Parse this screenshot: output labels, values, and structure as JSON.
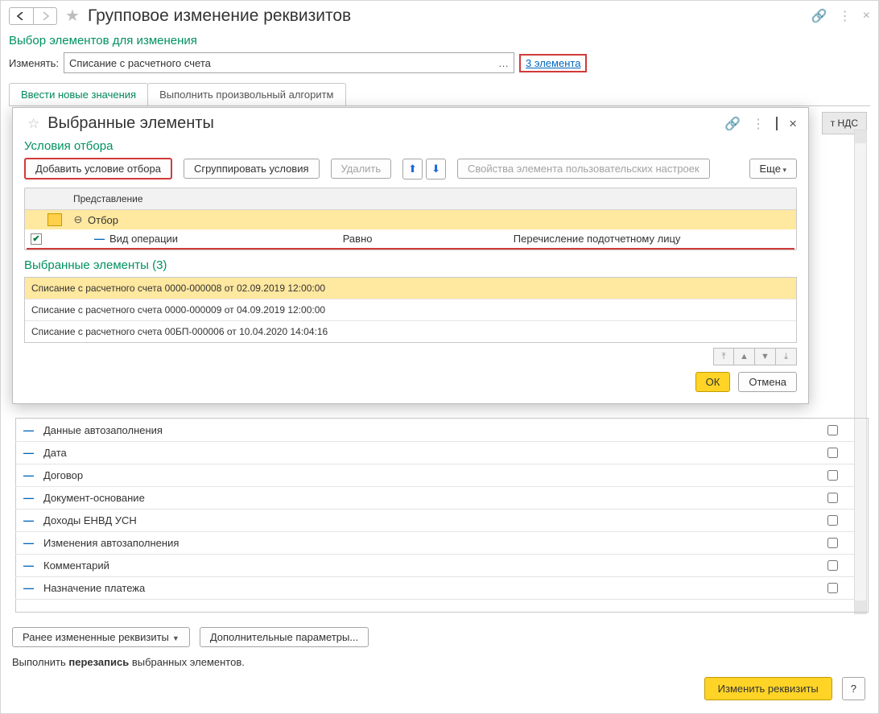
{
  "header": {
    "title": "Групповое изменение реквизитов"
  },
  "section1": {
    "title": "Выбор элементов для изменения",
    "change_label": "Изменять:",
    "change_value": "Списание с расчетного счета",
    "elements_link": "3 элемента"
  },
  "tabs": {
    "new_values": "Ввести новые значения",
    "algorithm": "Выполнить произвольный алгоритм"
  },
  "back_col_header": "т НДС",
  "modal": {
    "title": "Выбранные элементы",
    "section_title": "Условия отбора",
    "toolbar": {
      "add_condition": "Добавить условие отбора",
      "group": "Сгруппировать условия",
      "delete": "Удалить",
      "props": "Свойства элемента пользовательских настроек",
      "more": "Еще"
    },
    "filter": {
      "head": "Представление",
      "root": "Отбор",
      "row1": {
        "name": "Вид операции",
        "op": "Равно",
        "val": "Перечисление подотчетному лицу"
      }
    },
    "selected_title": "Выбранные элементы (3)",
    "selected": [
      "Списание с расчетного счета 0000-000008 от 02.09.2019 12:00:00",
      "Списание с расчетного счета 0000-000009 от 04.09.2019 12:00:00",
      "Списание с расчетного счета 00БП-000006 от 10.04.2020 14:04:16"
    ],
    "ok": "ОК",
    "cancel": "Отмена"
  },
  "back_list": [
    "Данные автозаполнения",
    "Дата",
    "Договор",
    "Документ-основание",
    "Доходы ЕНВД УСН",
    "Изменения автозаполнения",
    "Комментарий",
    "Назначение платежа"
  ],
  "footer": {
    "btn_prev": "Ранее измененные реквизиты",
    "btn_extra": "Дополнительные параметры...",
    "text_pre": "Выполнить ",
    "text_bold": "перезапись",
    "text_post": " выбранных элементов.",
    "main_action": "Изменить реквизиты",
    "help": "?"
  }
}
